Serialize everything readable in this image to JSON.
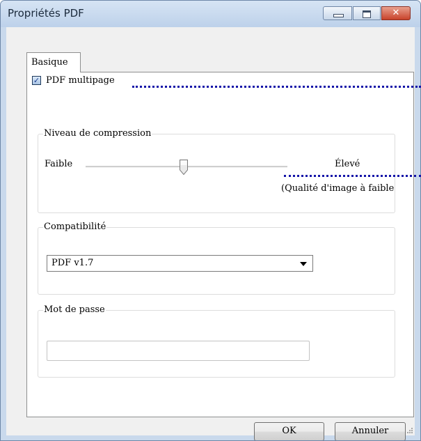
{
  "window": {
    "title": "Propriétés PDF"
  },
  "tabs": [
    {
      "label": "Basique"
    }
  ],
  "multipage": {
    "label": "PDF multipage",
    "checked": true
  },
  "compression": {
    "legend": "Niveau de compression",
    "low_label": "Faible",
    "high_label": "Élevé",
    "note": "(Qualité d'image à faible",
    "level": 0.5
  },
  "compatibility": {
    "legend": "Compatibilité",
    "selected": "PDF v1.7"
  },
  "password": {
    "legend": "Mot de passe",
    "value": ""
  },
  "buttons": {
    "ok": "OK",
    "cancel": "Annuler"
  },
  "colors": {
    "callout_dots": "#1414a8",
    "titlebar": "#c9d9ec",
    "close_button": "#c8432b"
  },
  "icons": {
    "minimize": "minimize-icon",
    "maximize": "maximize-icon",
    "close": "close-icon",
    "checkbox": "checkmark-icon",
    "dropdown": "chevron-down-icon"
  }
}
